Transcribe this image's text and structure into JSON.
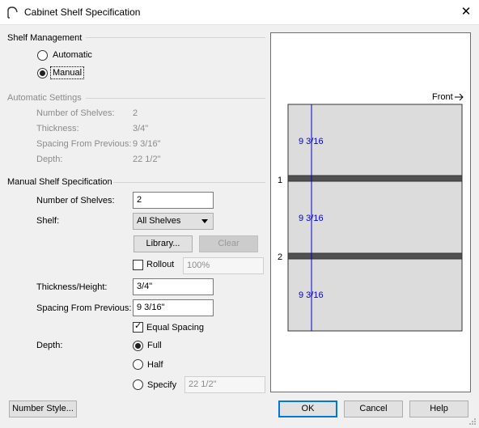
{
  "window": {
    "title": "Cabinet Shelf Specification",
    "icon": "cabinet-app-icon",
    "close_icon": "close-icon"
  },
  "shelf_management": {
    "label": "Shelf Management",
    "automatic_label": "Automatic",
    "manual_label": "Manual",
    "selected": "Manual"
  },
  "automatic_settings": {
    "label": "Automatic Settings",
    "rows": [
      {
        "label": "Number of Shelves:",
        "value": "2"
      },
      {
        "label": "Thickness:",
        "value": "3/4\""
      },
      {
        "label": "Spacing From Previous:",
        "value": "9 3/16\""
      },
      {
        "label": "Depth:",
        "value": "22 1/2\""
      }
    ]
  },
  "manual": {
    "label": "Manual Shelf Specification",
    "num_shelves_label": "Number of Shelves:",
    "num_shelves_value": "2",
    "shelf_label": "Shelf:",
    "shelf_value": "All Shelves",
    "library_button": "Library...",
    "clear_button": "Clear",
    "rollout_label": "Rollout",
    "rollout_value": "100%",
    "rollout_checked": false,
    "thickness_label": "Thickness/Height:",
    "thickness_value": "3/4\"",
    "spacing_label": "Spacing From Previous:",
    "spacing_value": "9 3/16\"",
    "equal_spacing_label": "Equal Spacing",
    "equal_spacing_checked": true,
    "depth_label": "Depth:",
    "depth_full": "Full",
    "depth_half": "Half",
    "depth_specify": "Specify",
    "depth_selected": "Full",
    "depth_specify_value": "22 1/2\""
  },
  "preview": {
    "front_label": "Front",
    "dimension_labels": [
      "9 3/16",
      "9 3/16",
      "9 3/16"
    ],
    "shelf_numbers": [
      "1",
      "2"
    ],
    "colors": {
      "cabinet": "#dcdcdc",
      "shelf": "#505050",
      "dimension": "#0000cc"
    }
  },
  "footer": {
    "number_style_button": "Number Style...",
    "ok_button": "OK",
    "cancel_button": "Cancel",
    "help_button": "Help"
  }
}
